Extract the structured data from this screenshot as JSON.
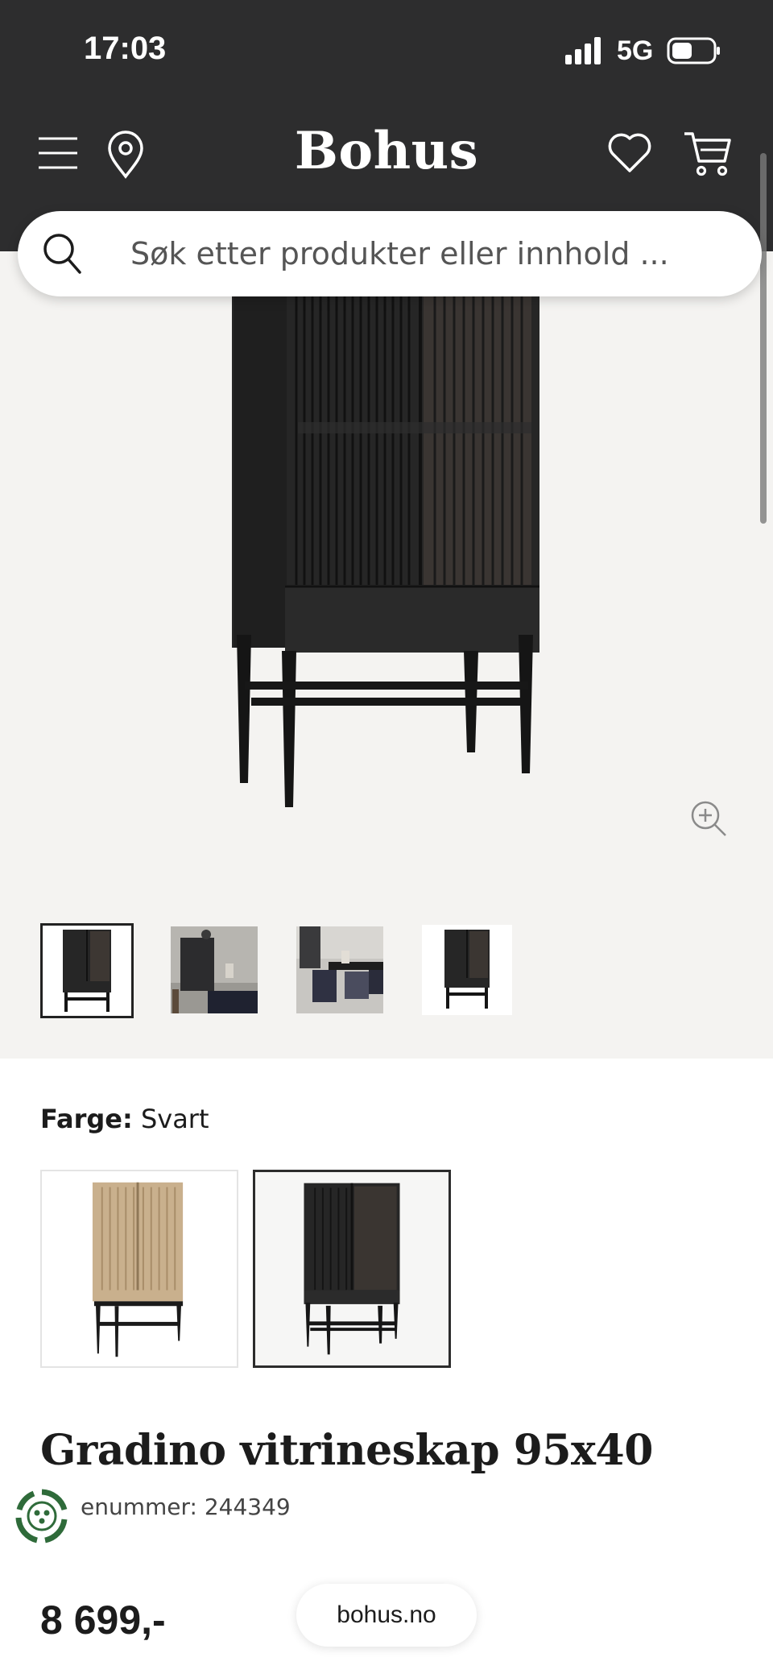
{
  "status_bar": {
    "time": "17:03",
    "network": "5G"
  },
  "header": {
    "brand": "Bohus",
    "icons": [
      "menu-icon",
      "location-pin-icon",
      "heart-icon",
      "cart-icon"
    ]
  },
  "search": {
    "placeholder": "Søk etter produkter eller innhold ..."
  },
  "gallery": {
    "thumbnail_count": 4,
    "active_thumbnail": 0
  },
  "color": {
    "label": "Farge:",
    "value": "Svart",
    "options": [
      "oak",
      "black"
    ],
    "selected_index": 1
  },
  "product": {
    "title": "Gradino vitrineskap 95x40",
    "number_text": "enummer: 244349",
    "price": "8 699,-"
  },
  "footer": {
    "url": "bohus.no"
  },
  "colors": {
    "header_bg": "#2d2d2e",
    "gallery_bg": "#f4f3f1",
    "text": "#1c1c1c"
  }
}
